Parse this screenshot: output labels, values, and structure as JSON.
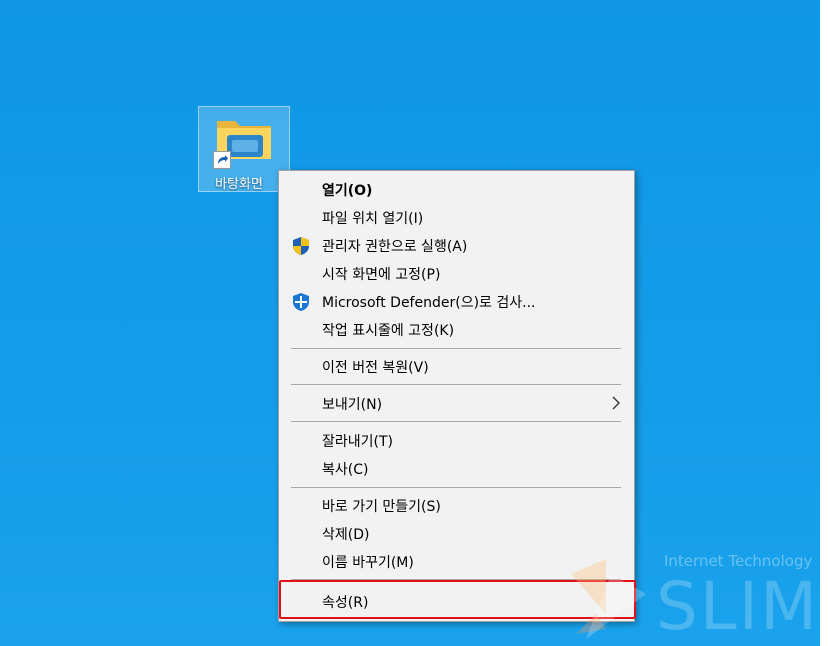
{
  "desktop": {
    "background": "#139ce8",
    "shortcut": {
      "label": "바탕화면",
      "icon": "folder-shortcut-icon"
    }
  },
  "context_menu": {
    "items": [
      {
        "label": "열기(O)",
        "bold": true
      },
      {
        "label": "파일 위치 열기(I)"
      },
      {
        "label": "관리자 권한으로 실행(A)",
        "icon": "uac-shield-icon"
      },
      {
        "label": "시작 화면에 고정(P)"
      },
      {
        "label": "Microsoft Defender(으)로 검사...",
        "icon": "defender-shield-icon"
      },
      {
        "label": "작업 표시줄에 고정(K)"
      },
      {
        "label": "이전 버전 복원(V)"
      },
      {
        "label": "보내기(N)",
        "submenu": true
      },
      {
        "label": "잘라내기(T)"
      },
      {
        "label": "복사(C)"
      },
      {
        "label": "바로 가기 만들기(S)"
      },
      {
        "label": "삭제(D)"
      },
      {
        "label": "이름 바꾸기(M)"
      },
      {
        "label": "속성(R)",
        "highlighted": true
      }
    ],
    "highlight_color": "#e0101a"
  },
  "watermark": {
    "line1": "Internet Technology",
    "line2": "SLIM"
  }
}
